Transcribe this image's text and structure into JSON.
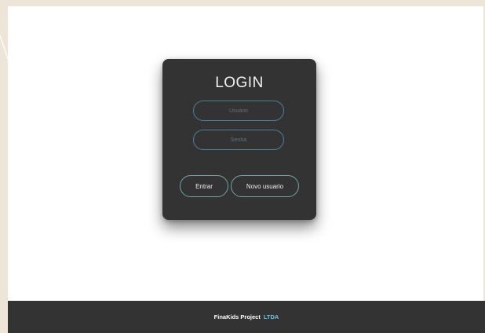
{
  "login": {
    "title": "LOGIN",
    "username_placeholder": "Usuário",
    "password_placeholder": "Senha",
    "submit_label": "Entrar",
    "new_user_label": "Novo usuario"
  },
  "footer": {
    "brand": "FinaKids Project",
    "suffix": "LTDA"
  },
  "colors": {
    "card_background": "#333333",
    "page_background": "#ffffff",
    "outer_background": "#ede6d8",
    "field_border": "#4a7f9a",
    "button_border": "#6fa5a6",
    "footer_accent": "#6ec6e6"
  }
}
